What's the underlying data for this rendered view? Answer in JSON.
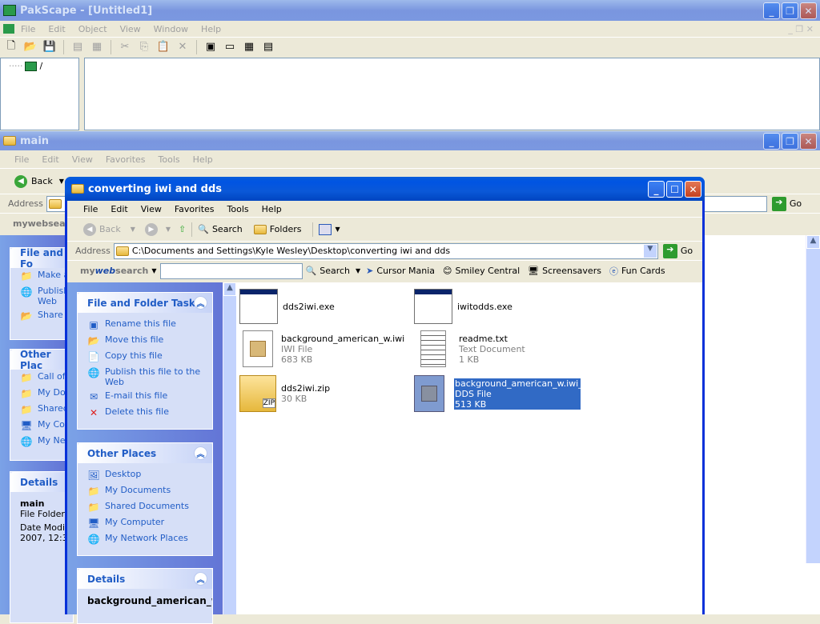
{
  "pakscape": {
    "title": "PakScape - [Untitled1]",
    "menu": [
      "File",
      "Edit",
      "Object",
      "View",
      "Window",
      "Help"
    ],
    "tree_root": "/"
  },
  "main": {
    "title": "main",
    "menu": [
      "File",
      "Edit",
      "View",
      "Favorites",
      "Tools",
      "Help"
    ],
    "back_label": "Back",
    "address_label": "Address",
    "go_label": "Go",
    "mywebsearch": "mywebsea",
    "tasks_title": "File and Fo",
    "tasks": [
      "Make a",
      "Publish",
      "Web",
      "Share"
    ],
    "places_title": "Other Plac",
    "places": [
      "Call of",
      "My Do",
      "Shared",
      "My Co",
      "My Ne"
    ],
    "details_title": "Details",
    "details_name": "main",
    "details_type": "File Folder",
    "details_date1": "Date Modifi",
    "details_date2": "2007, 12:3"
  },
  "front": {
    "title": "converting iwi and dds",
    "menu": [
      "File",
      "Edit",
      "View",
      "Favorites",
      "Tools",
      "Help"
    ],
    "toolbar": {
      "back": "Back",
      "search": "Search",
      "folders": "Folders"
    },
    "address_label": "Address",
    "address_value": "C:\\Documents and Settings\\Kyle Wesley\\Desktop\\converting iwi and dds",
    "go_label": "Go",
    "mws": {
      "brand_my": "my",
      "brand_web": "web",
      "brand_search": "search",
      "search_btn": "Search",
      "links": [
        "Cursor Mania",
        "Smiley Central",
        "Screensavers",
        "Fun Cards"
      ]
    },
    "tasks": {
      "title": "File and Folder Tasks",
      "items": [
        "Rename this file",
        "Move this file",
        "Copy this file",
        "Publish this file to the Web",
        "E-mail this file",
        "Delete this file"
      ]
    },
    "places": {
      "title": "Other Places",
      "items": [
        "Desktop",
        "My Documents",
        "Shared Documents",
        "My Computer",
        "My Network Places"
      ]
    },
    "details": {
      "title": "Details",
      "name": "background_american_w"
    },
    "files": [
      {
        "name": "dds2iwi.exe",
        "type": "",
        "size": ""
      },
      {
        "name": "iwitodds.exe",
        "type": "",
        "size": ""
      },
      {
        "name": "background_american_w.iwi",
        "type": "IWI File",
        "size": "683 KB"
      },
      {
        "name": "readme.txt",
        "type": "Text Document",
        "size": "1 KB"
      },
      {
        "name": "dds2iwi.zip",
        "type": "",
        "size": "30 KB"
      },
      {
        "name": "background_american_w.iwi_...",
        "type": "DDS File",
        "size": "513 KB"
      }
    ]
  }
}
